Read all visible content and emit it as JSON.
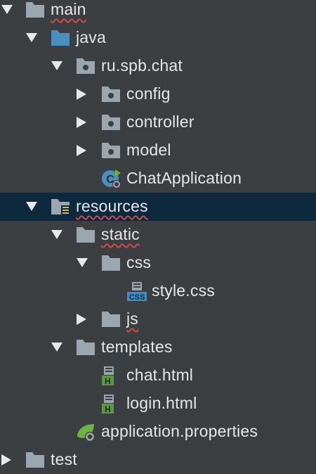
{
  "tree": {
    "main": "main",
    "java": "java",
    "package": "ru.spb.chat",
    "config": "config",
    "controller": "controller",
    "model": "model",
    "chat_app": "ChatApplication",
    "resources": "resources",
    "static": "static",
    "css": "css",
    "style_css": "style.css",
    "js": "js",
    "templates": "templates",
    "chat_html": "chat.html",
    "login_html": "login.html",
    "app_props": "application.properties",
    "test": "test"
  },
  "icon_text": {
    "css_badge": "CSS",
    "html_badge": "H"
  },
  "colors": {
    "background": "#3c3f41",
    "selection": "#0d293e",
    "folder": "#9aa7b0",
    "source_folder": "#4a8fbf",
    "html_badge": "#5a9a3a",
    "css_badge": "#3b8fc6",
    "spring": "#6db33f"
  }
}
